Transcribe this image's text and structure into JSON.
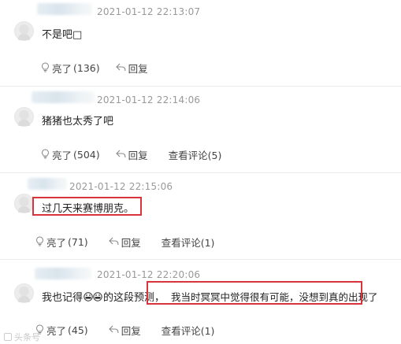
{
  "comments": [
    {
      "time": "2021-01-12 22:13:07",
      "text": "不是吧□",
      "like_label": "亮了",
      "like_count": "(136)",
      "reply_label": "回复",
      "view_replies": ""
    },
    {
      "time": "2021-01-12 22:14:06",
      "text": "猪猪也太秀了吧",
      "like_label": "亮了",
      "like_count": "(504)",
      "reply_label": "回复",
      "view_replies": "查看评论(5)"
    },
    {
      "time": "2021-01-12 22:15:06",
      "text": "过几天来赛博朋克。",
      "like_label": "亮了",
      "like_count": "(71)",
      "reply_label": "回复",
      "view_replies": "查看评论(1)"
    },
    {
      "time": "2021-01-12 22:20:06",
      "text_part1": "我也记得",
      "text_part2": "的这段预测，",
      "text_part3": "我当时冥冥中觉得很有可能，没想到真的出现了",
      "like_label": "亮了",
      "like_count": "(45)",
      "reply_label": "回复",
      "view_replies": "查看评论(1)"
    }
  ],
  "watermark": "头条号",
  "colors": {
    "highlight": "#d9343b",
    "timestamp": "#999999",
    "separator": "#ebebeb"
  },
  "icons": {
    "like": "lightbulb-icon",
    "reply": "reply-arrow-icon",
    "emoji": "grimace-emoji-icon"
  }
}
